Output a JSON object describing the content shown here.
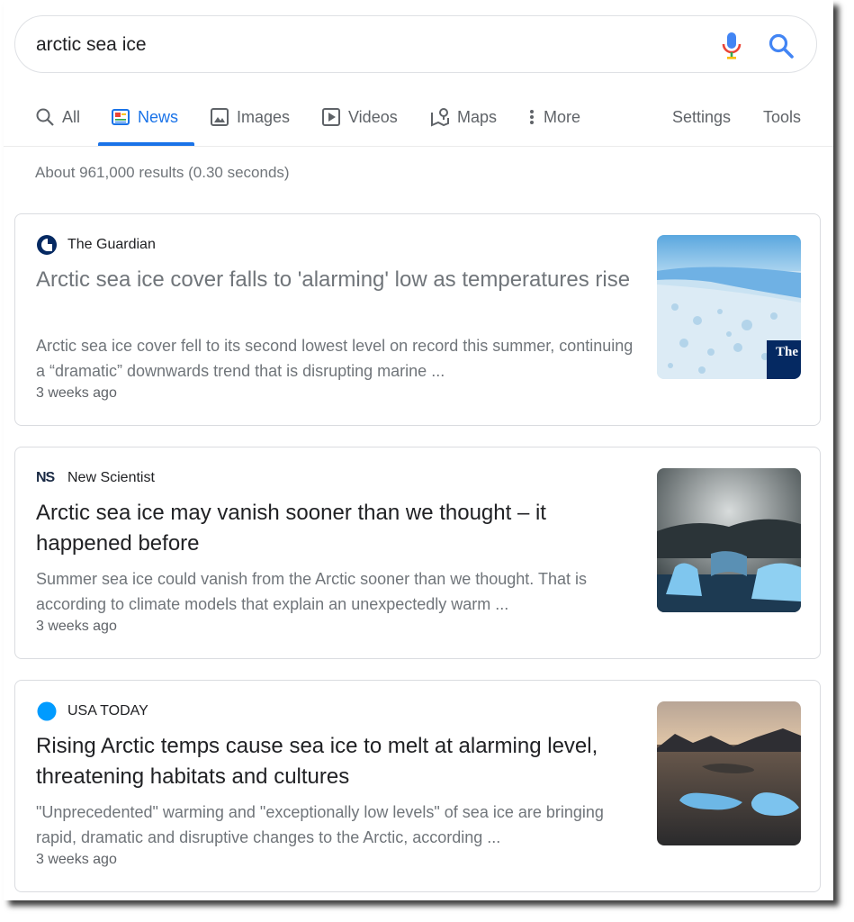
{
  "search": {
    "query": "arctic sea ice"
  },
  "tabs": [
    {
      "label": "All",
      "icon": "search-icon"
    },
    {
      "label": "News",
      "icon": "news-icon",
      "active": true
    },
    {
      "label": "Images",
      "icon": "image-icon"
    },
    {
      "label": "Videos",
      "icon": "video-icon"
    },
    {
      "label": "Maps",
      "icon": "map-icon"
    },
    {
      "label": "More",
      "icon": "more-vert-icon"
    }
  ],
  "tools": {
    "settings": "Settings",
    "tools": "Tools"
  },
  "stats": "About 961,000 results (0.30 seconds)",
  "results": [
    {
      "source": "The Guardian",
      "title": "Arctic sea ice cover falls to 'alarming' low as temperatures rise",
      "snippet": "Arctic sea ice cover fell to its second lowest level on record this summer, continuing a “dramatic” downwards trend that is disrupting marine ...",
      "age": "3 weeks ago",
      "thumb_badge": "The Gua"
    },
    {
      "source": "New Scientist",
      "source_logo_text": "NS",
      "title": "Arctic sea ice may vanish sooner than we thought – it happened before",
      "snippet": "Summer sea ice could vanish from the Arctic sooner than we thought. That is according to climate models that explain an unexpectedly warm ...",
      "age": "3 weeks ago"
    },
    {
      "source": "USA TODAY",
      "title": "Rising Arctic temps cause sea ice to melt at alarming level, threatening habitats and cultures",
      "snippet": "\"Unprecedented\" warming and \"exceptionally low levels\" of sea ice are bringing rapid, dramatic and disruptive changes to the Arctic, according ...",
      "age": "3 weeks ago"
    }
  ],
  "colors": {
    "accent": "#1a73e8",
    "visited_title": "#70757a",
    "usa_today_dot": "#009bff",
    "guardian_blue": "#052962"
  }
}
